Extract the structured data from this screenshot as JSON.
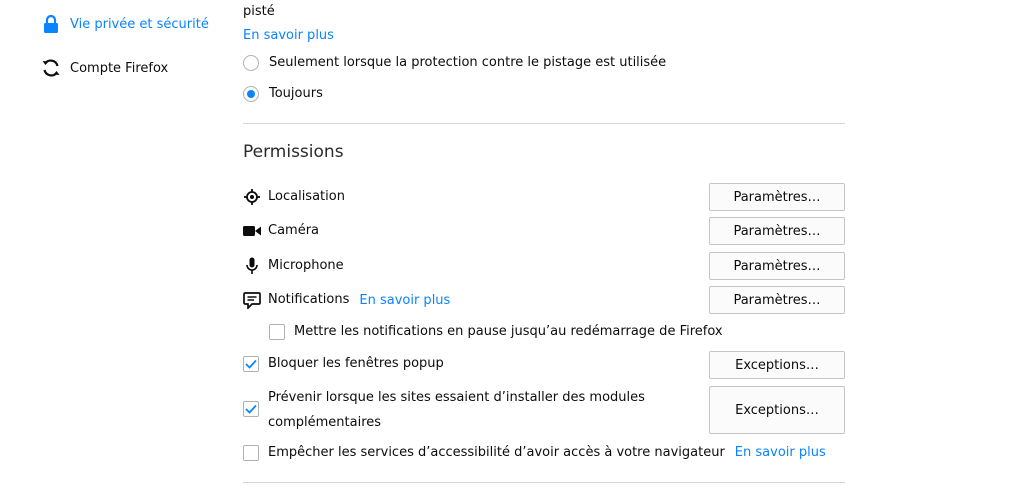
{
  "colors": {
    "accent": "#0a84ff",
    "divider": "#d7d7db",
    "text": "#0c0c0d"
  },
  "sidebar": {
    "items": [
      {
        "label": "Vie privée et sécurité",
        "icon": "lock-icon",
        "selected": true
      },
      {
        "label": "Compte Firefox",
        "icon": "sync-icon",
        "selected": false
      }
    ]
  },
  "tracking": {
    "partial_text": "pisté",
    "learn_more": "En savoir plus",
    "options": [
      {
        "label": "Seulement lorsque la protection contre le pistage est utilisée",
        "selected": false
      },
      {
        "label": "Toujours",
        "selected": true
      }
    ]
  },
  "permissions": {
    "title": "Permissions",
    "items": [
      {
        "label": "Localisation",
        "icon": "location-icon",
        "button": "Paramètres…"
      },
      {
        "label": "Caméra",
        "icon": "camera-icon",
        "button": "Paramètres…"
      },
      {
        "label": "Microphone",
        "icon": "microphone-icon",
        "button": "Paramètres…"
      },
      {
        "label": "Notifications",
        "icon": "notification-icon",
        "button": "Paramètres…",
        "learn_more": "En savoir plus"
      }
    ],
    "pause_notifications": {
      "label": "Mettre les notifications en pause jusqu’au redémarrage de Firefox",
      "checked": false
    },
    "block_popups": {
      "label": "Bloquer les fenêtres popup",
      "checked": true,
      "button": "Exceptions…"
    },
    "warn_addons": {
      "label": "Prévenir lorsque les sites essaient d’installer des modules complémentaires",
      "checked": true,
      "button": "Exceptions…"
    },
    "accessibility": {
      "label": "Empêcher les services d’accessibilité d’avoir accès à votre navigateur",
      "checked": false,
      "learn_more": "En savoir plus"
    }
  }
}
